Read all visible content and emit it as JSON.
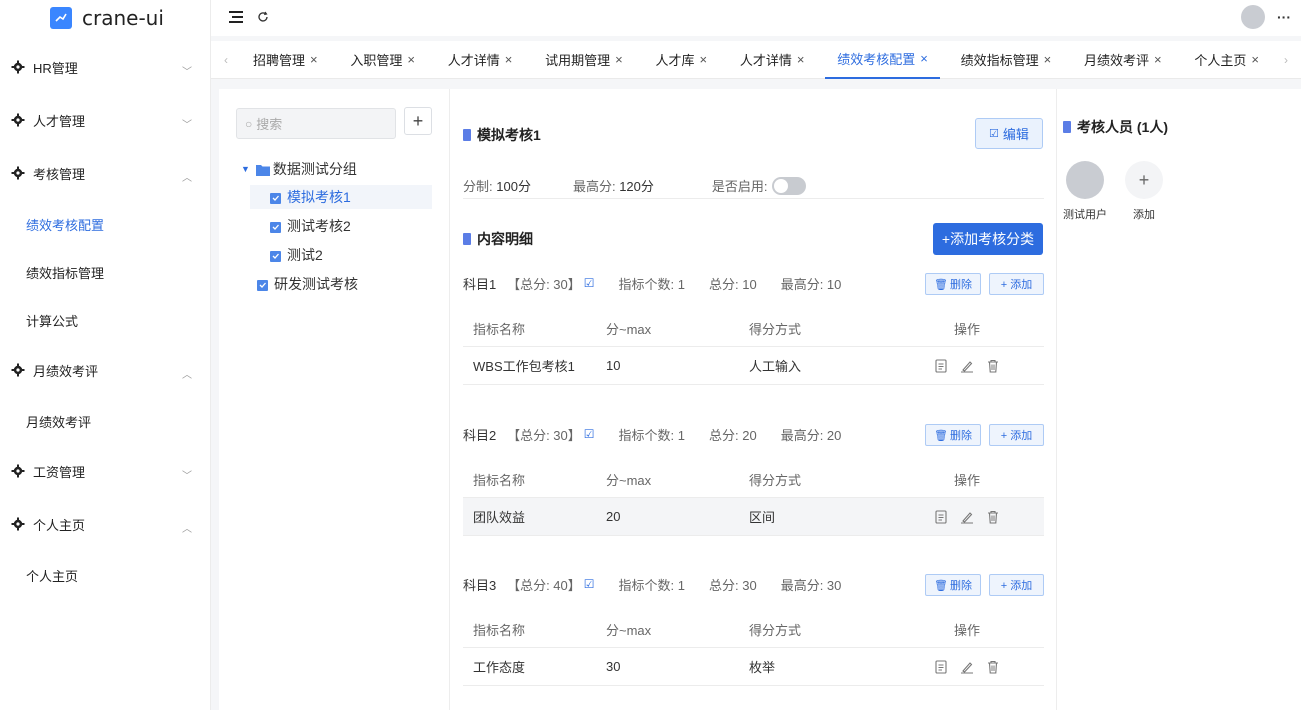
{
  "app": {
    "logo_text": "crane-ui"
  },
  "sidebar": {
    "items": [
      {
        "type": "group",
        "label": "HR管理",
        "expanded": false
      },
      {
        "type": "group",
        "label": "人才管理",
        "expanded": false
      },
      {
        "type": "group",
        "label": "考核管理",
        "expanded": true
      },
      {
        "type": "sub",
        "label": "绩效考核配置",
        "active": true
      },
      {
        "type": "sub",
        "label": "绩效指标管理"
      },
      {
        "type": "sub",
        "label": "计算公式"
      },
      {
        "type": "group",
        "label": "月绩效考评",
        "expanded": true
      },
      {
        "type": "sub",
        "label": "月绩效考评"
      },
      {
        "type": "group",
        "label": "工资管理",
        "expanded": false
      },
      {
        "type": "group",
        "label": "个人主页",
        "expanded": true
      },
      {
        "type": "sub",
        "label": "个人主页"
      }
    ]
  },
  "tabs": [
    {
      "label": "招聘管理"
    },
    {
      "label": "入职管理"
    },
    {
      "label": "人才详情"
    },
    {
      "label": "试用期管理"
    },
    {
      "label": "人才库"
    },
    {
      "label": "人才详情"
    },
    {
      "label": "绩效考核配置",
      "active": true
    },
    {
      "label": "绩效指标管理"
    },
    {
      "label": "月绩效考评"
    },
    {
      "label": "个人主页"
    }
  ],
  "tree": {
    "search_placeholder": "搜索",
    "group_label": "数据测试分组",
    "nodes": [
      "模拟考核1",
      "测试考核2",
      "测试2"
    ],
    "root_leaf": "研发测试考核"
  },
  "detail": {
    "title": "模拟考核1",
    "edit_label": "编辑",
    "score_label": "分制:",
    "score_value": "100分",
    "max_label": "最高分:",
    "max_value": "120分",
    "enabled_label": "是否启用:",
    "enabled": false,
    "content_title": "内容明细",
    "add_category_label": "+添加考核分类",
    "delete_label": "删除",
    "add_label": "+ 添加",
    "col_name": "指标名称",
    "col_max": "分~max",
    "col_method": "得分方式",
    "col_ops": "操作",
    "subjects": [
      {
        "name": "科目1",
        "total": "【总分: 30】",
        "count": "指标个数: 1",
        "sum": "总分: 10",
        "max": "最高分: 10",
        "rows": [
          {
            "name": "WBS工作包考核1",
            "max": "10",
            "method": "人工输入"
          }
        ]
      },
      {
        "name": "科目2",
        "total": "【总分: 30】",
        "count": "指标个数: 1",
        "sum": "总分: 20",
        "max": "最高分: 20",
        "rows": [
          {
            "name": "团队效益",
            "max": "20",
            "method": "区间"
          }
        ]
      },
      {
        "name": "科目3",
        "total": "【总分: 40】",
        "count": "指标个数: 1",
        "sum": "总分: 30",
        "max": "最高分: 30",
        "rows": [
          {
            "name": "工作态度",
            "max": "30",
            "method": "枚举"
          }
        ]
      }
    ]
  },
  "reviewers": {
    "title": "考核人员 (1人)",
    "people": [
      {
        "name": "测试用户"
      }
    ],
    "add_label": "添加"
  },
  "colors": {
    "accent": "#2d6cdf",
    "panel": "#ffffff",
    "bg": "#f5f6f8"
  }
}
